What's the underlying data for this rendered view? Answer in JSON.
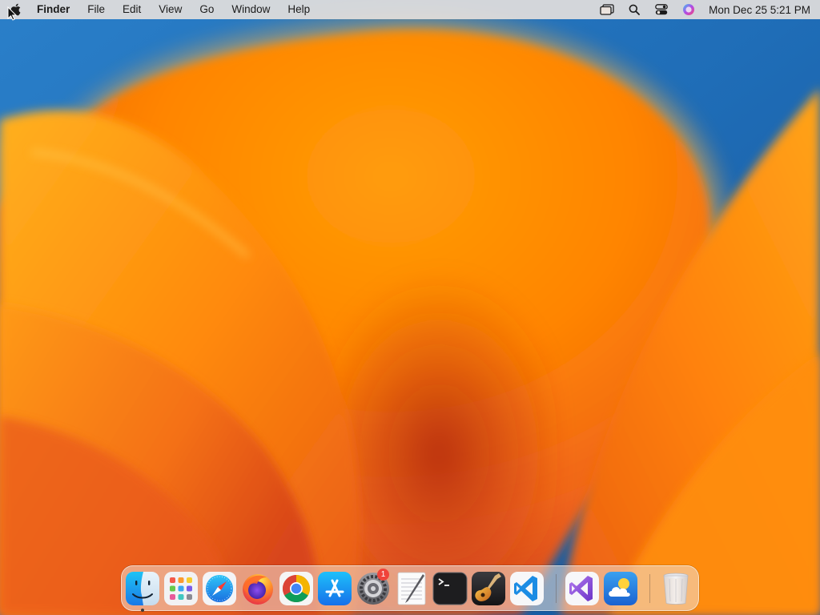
{
  "menubar": {
    "apple_icon": "apple-logo-icon",
    "app_name": "Finder",
    "menus": [
      "File",
      "Edit",
      "View",
      "Go",
      "Window",
      "Help"
    ],
    "status_icons": [
      "window-screens-icon",
      "spotlight-search-icon",
      "control-center-icon",
      "siri-icon"
    ],
    "clock": "Mon Dec 25  5:21 PM"
  },
  "dock": {
    "apps": [
      {
        "name": "Finder",
        "icon": "finder-icon",
        "running": true
      },
      {
        "name": "Launchpad",
        "icon": "launchpad-icon"
      },
      {
        "name": "Safari",
        "icon": "safari-icon"
      },
      {
        "name": "Firefox",
        "icon": "firefox-icon"
      },
      {
        "name": "Google Chrome",
        "icon": "chrome-icon"
      },
      {
        "name": "App Store",
        "icon": "app-store-icon"
      },
      {
        "name": "System Settings",
        "icon": "system-settings-icon",
        "badge": "1"
      },
      {
        "name": "TextEdit",
        "icon": "textedit-icon"
      },
      {
        "name": "Terminal",
        "icon": "terminal-icon"
      },
      {
        "name": "GarageBand",
        "icon": "garageband-icon"
      },
      {
        "name": "Visual Studio Code",
        "icon": "vscode-icon"
      },
      {
        "name": "Visual Studio",
        "icon": "visual-studio-icon"
      },
      {
        "name": "Weather",
        "icon": "weather-icon"
      },
      {
        "name": "Trash",
        "icon": "trash-icon"
      }
    ]
  },
  "colors": {
    "wallpaper_blue": "#1e6fb8",
    "wallpaper_orange": "#ff8a00",
    "wallpaper_red": "#c7321a",
    "badge_red": "#f0433a"
  }
}
